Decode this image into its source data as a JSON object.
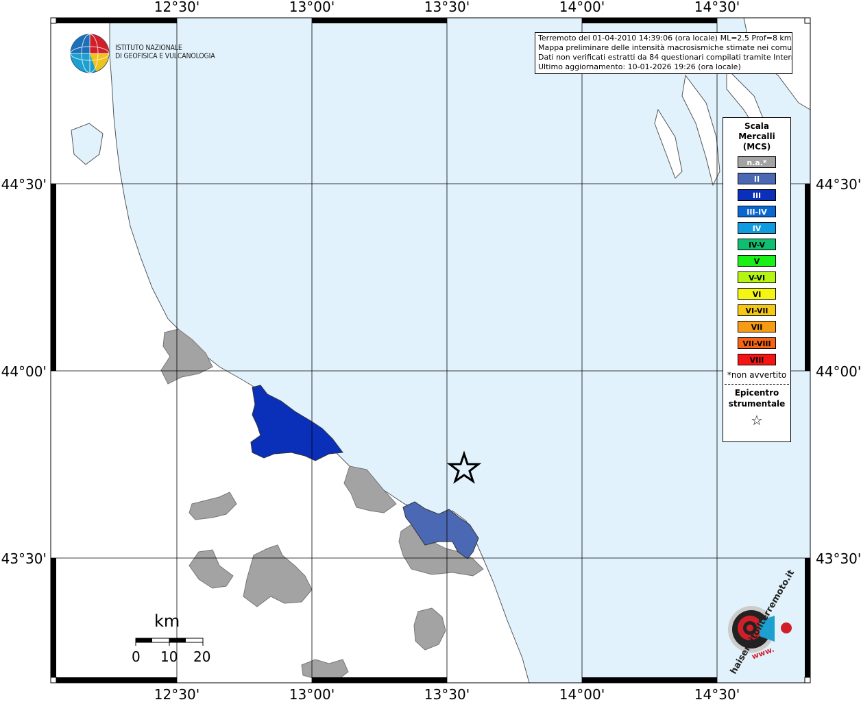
{
  "map": {
    "grid_longitudes": [
      "12°30'",
      "13°00'",
      "13°30'",
      "14°00'",
      "14°30'"
    ],
    "grid_latitudes": [
      "44°30'",
      "44°00'",
      "43°30'"
    ],
    "colors": {
      "sea": "#e1f2fc",
      "land": "#ffffff",
      "not_felt": "#a3a3a3",
      "intensity_II": "#4a68b3",
      "intensity_III": "#0a2fb8"
    }
  },
  "info_box": {
    "line1": "Terremoto del 01-04-2010 14:39:06 (ora locale) ML=2.5 Prof=8 km",
    "line2": "Mappa preliminare delle intensità macrosismiche stimate nei comuni",
    "line3": "Dati non verificati estratti da 84 questionari compilati tramite Internet.",
    "line4": "Ultimo aggiornamento: 10-01-2026 19:26 (ora locale)"
  },
  "logo": {
    "org_line1": "ISTITUTO NAZIONALE",
    "org_line2": "DI GEOFISICA E VULCANOLOGIA",
    "hst_text": "haisentitoilterremoto.it",
    "hst_prefix": "www."
  },
  "legend": {
    "title_line1": "Scala",
    "title_line2": "Mercalli",
    "title_line3": "(MCS)",
    "items": [
      {
        "label": "n.a.*",
        "color": "#a3a3a3",
        "dark": false
      },
      {
        "label": "II",
        "color": "#4a68b3",
        "dark": false
      },
      {
        "label": "III",
        "color": "#0a2fb8",
        "dark": false
      },
      {
        "label": "III-IV",
        "color": "#0a67d0",
        "dark": false
      },
      {
        "label": "IV",
        "color": "#0f9be0",
        "dark": false
      },
      {
        "label": "IV-V",
        "color": "#0fbe6e",
        "dark": true
      },
      {
        "label": "V",
        "color": "#18f018",
        "dark": true
      },
      {
        "label": "V-VI",
        "color": "#b4f514",
        "dark": true
      },
      {
        "label": "VI",
        "color": "#f5f514",
        "dark": true
      },
      {
        "label": "VI-VII",
        "color": "#f5c814",
        "dark": true
      },
      {
        "label": "VII",
        "color": "#f59b14",
        "dark": true
      },
      {
        "label": "VII-VIII",
        "color": "#f56414",
        "dark": true
      },
      {
        "label": "VIII",
        "color": "#f51414",
        "dark": true
      }
    ],
    "note": "*non avvertito",
    "epicenter_line1": "Epicentro",
    "epicenter_line2": "strumentale",
    "star_glyph": "☆"
  },
  "scalebar": {
    "unit": "km",
    "labels": [
      "0",
      "10",
      "20"
    ]
  }
}
